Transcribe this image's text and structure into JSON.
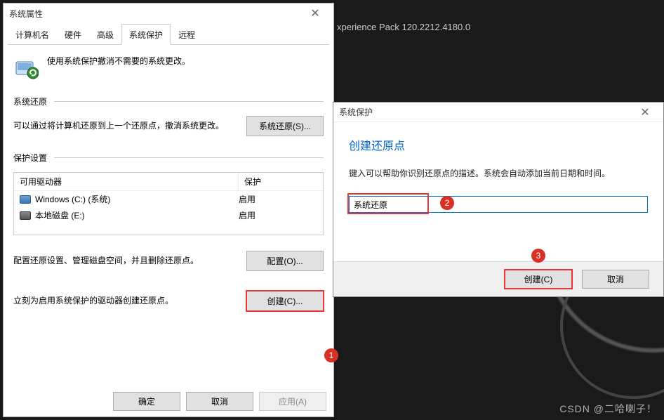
{
  "background": {
    "experience_pack": "xperience Pack 120.2212.4180.0"
  },
  "dlg1": {
    "title": "系统属性",
    "tabs": [
      "计算机名",
      "硬件",
      "高级",
      "系统保护",
      "远程"
    ],
    "active_tab_index": 3,
    "intro_text": "使用系统保护撤消不需要的系统更改。",
    "section_restore": {
      "title": "系统还原",
      "text": "可以通过将计算机还原到上一个还原点，撤消系统更改。",
      "button": "系统还原(S)..."
    },
    "section_protection": {
      "title": "保护设置",
      "col_drive": "可用驱动器",
      "col_prot": "保护",
      "rows": [
        {
          "icon": "blue",
          "name": "Windows (C:) (系统)",
          "status": "启用"
        },
        {
          "icon": "gray",
          "name": "本地磁盘 (E:)",
          "status": "启用"
        }
      ],
      "config_text": "配置还原设置、管理磁盘空间，并且删除还原点。",
      "config_button": "配置(O)...",
      "create_text": "立刻为启用系统保护的驱动器创建还原点。",
      "create_button": "创建(C)..."
    },
    "buttons": {
      "ok": "确定",
      "cancel": "取消",
      "apply": "应用(A)"
    }
  },
  "dlg2": {
    "title": "系统保护",
    "heading": "创建还原点",
    "desc": "键入可以帮助你识别还原点的描述。系统会自动添加当前日期和时间。",
    "input_value": "系统还原",
    "buttons": {
      "create": "创建(C)",
      "cancel": "取消"
    }
  },
  "callouts": {
    "c1": "1",
    "c2": "2",
    "c3": "3"
  },
  "watermark": "CSDN @二哈喇子！"
}
